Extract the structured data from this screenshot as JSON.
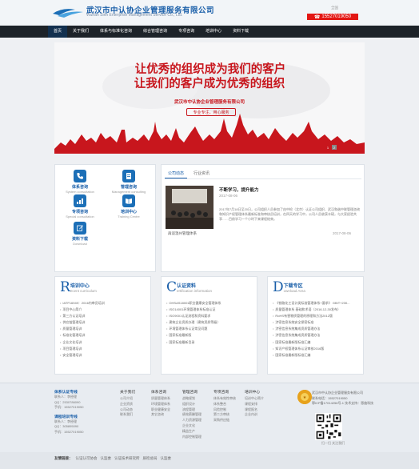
{
  "header": {
    "company_cn": "武汉市中认协企业管理服务有限公司",
    "company_en": "Wuhan Sinn Enterprise Management Service Co., Ltd.",
    "hotline_label": "全国",
    "phone": "15527019050",
    "brand_color": "#1a5fa9"
  },
  "nav": {
    "items": [
      "首页",
      "关于我们",
      "体系与标准化咨询",
      "综合管理咨询",
      "专项咨询",
      "培训中心",
      "资料下载"
    ],
    "active_index": 0
  },
  "banner": {
    "line1": "让优秀的组织成为我们的客户",
    "line2": "让我们的客户成为优秀的组织",
    "company": "武汉市中认协企业管理服务有限公司",
    "slogan": "专业专注，用心服务",
    "pages": [
      "1",
      "2"
    ],
    "accent_color": "#c8161d"
  },
  "services": {
    "items": [
      {
        "name": "体系咨询",
        "en": "System consultation",
        "icon": "phone-icon"
      },
      {
        "name": "管理咨询",
        "en": "Management consulting",
        "icon": "document-icon"
      },
      {
        "name": "专项咨询",
        "en": "Special consultation",
        "icon": "chart-icon"
      },
      {
        "name": "培训中心",
        "en": "Training Centre",
        "icon": "book-icon"
      },
      {
        "name": "资料下载",
        "en": "Download",
        "icon": "edit-icon"
      }
    ]
  },
  "news": {
    "tabs": [
      "公司动态",
      "行业资讯"
    ],
    "active_tab": 0,
    "featured": {
      "title": "不断学习，提升能力",
      "date": "2017-08-06",
      "excerpt": "2017年7月18日至20日，公司组织人员参加了由中检（北京）认证公司组织、武汉和谐中联管理咨询和知识产权管理体系最新标准和审核员培训，在四天的学习中，公司人员收获丰硕，与大家经验共享……目前学习一个小时下来课程结束。"
    },
    "items": [
      {
        "title": "再谈温州管理体系",
        " date": "",
        "date": "2017-08-06"
      }
    ]
  },
  "columns": [
    {
      "letter": "R",
      "title": "培训中心",
      "en": "ecent curriculum",
      "items": [
        "IATF16949：2016内审员培训",
        "项目中心简介",
        "第三方认证培训",
        "供应链管理培训",
        "质量管理培训",
        "标准化管理培训",
        "企业文化培训",
        "项目管理培训",
        "安全管理培训"
      ]
    },
    {
      "letter": "C",
      "title": "认证资料",
      "en": "ertification information",
      "items": [
        "OHSAS18001职业健康安全管理体系",
        "ISO14001环境管理体系标准认证",
        "ISO9001认证流程和资料要求",
        "建筑企业资质办理（建筑资质等级）",
        "环境管理体系认证常见问题",
        "国家标准最新版",
        "国家标准最新目录"
      ]
    },
    {
      "letter": "D",
      "title": "下载专区",
      "en": "ownload Area",
      "items": [
        "《铁路化工设计类标准管理体系+要求》 GB/T+230...",
        "质量管理体系 基础和术语（2016-12-30发布）",
        "RoHS有害物质管理的原理和方法2012版",
        "涉密信息系统安全保密标准",
        "涉密信息系统集成资质管理办法",
        "涉密信息系统集成资质管理办法",
        "国家标准最新版标准汇编",
        "知识产权管理体系认证审核2016版",
        "国家标准最新版标准汇编"
      ]
    }
  ],
  "footer": {
    "contacts": [
      {
        "title": "体系认证专线",
        "lines": [
          "联系人：李经理",
          "QQ：2530786090",
          "手机：15527019050"
        ]
      },
      {
        "title": "课程培训专线",
        "lines": [
          "联系人：李经理",
          "QQ：305895090",
          "手机：15527019050"
        ]
      }
    ],
    "columns": [
      {
        "title": "关于我们",
        "items": [
          "公司介绍",
          "企业资质",
          "公司动态",
          "联系我们"
        ]
      },
      {
        "title": "体系咨询",
        "items": [
          "质量管理体系",
          "环境管理体系",
          "职业健康安全",
          "其它咨询"
        ]
      },
      {
        "title": "管理咨询",
        "items": [
          "战略规划",
          "组织设计",
          "流程管理",
          "绩效薪酬管理",
          "人力资源管理",
          "企业文化",
          "精益生产",
          "内部控制管理"
        ]
      },
      {
        "title": "专项咨询",
        "items": [
          "体系有效性审核",
          "体系整合",
          "风险控制",
          "第二方审核",
          "采购供应链"
        ]
      },
      {
        "title": "培训中心",
        "items": [
          "培训中心简介",
          "课程安排",
          "课程报名",
          "企业内训"
        ]
      }
    ],
    "info": [
      "武汉市中认协企业管理服务有限公司",
      "联系电话：15527019050",
      "鄂ICP备17014256号-1  技术支持：恩施科技"
    ],
    "qr_label": "扫一扫 关注我们"
  },
  "links": {
    "label": "友情链接：",
    "items": [
      "认证认可协会",
      "认监委",
      "认证技术研究所",
      "质检总局",
      "认监委"
    ]
  }
}
